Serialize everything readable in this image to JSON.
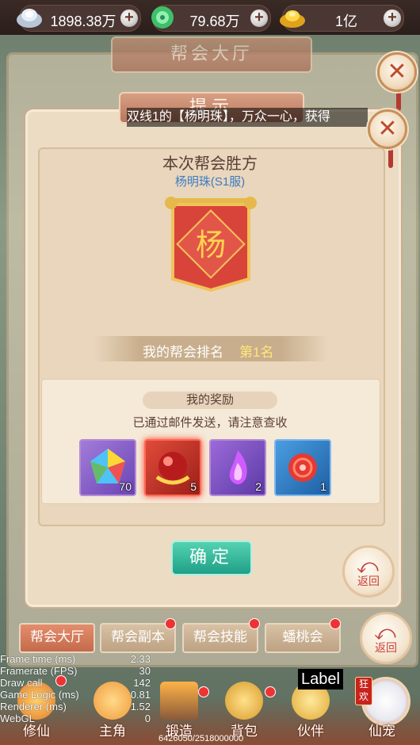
{
  "currency": {
    "silver": "1898.38万",
    "jade": "79.68万",
    "gold": "1亿",
    "plus": "+"
  },
  "hall": {
    "title": "帮会大厅"
  },
  "dialog": {
    "title": "提示",
    "marquee": "双线1的【杨明珠】，万众一心，获得",
    "winner_heading": "本次帮会胜方",
    "winner_name": "杨明珠(S1服)",
    "banner_char": "杨",
    "rank_label": "我的帮会排名",
    "rank_value": "第1名",
    "reward_title": "我的奖励",
    "reward_note": "已通过邮件发送，请注意查收",
    "rewards": [
      {
        "icon": "rainbow-gem-icon",
        "count": "70"
      },
      {
        "icon": "red-orb-icon",
        "count": "5"
      },
      {
        "icon": "purple-flame-icon",
        "count": "2"
      },
      {
        "icon": "red-disc-icon",
        "count": "1"
      }
    ],
    "confirm": "确定",
    "return": "返回"
  },
  "tabs": [
    "帮会大厅",
    "帮会副本",
    "帮会技能",
    "蟠桃会"
  ],
  "return2": "返回",
  "debug": [
    {
      "k": "Frame time (ms)",
      "v": "2.33"
    },
    {
      "k": "Framerate (FPS)",
      "v": "30"
    },
    {
      "k": "Draw call",
      "v": "142"
    },
    {
      "k": "Game Logic (ms)",
      "v": "0.81"
    },
    {
      "k": "Renderer (ms)",
      "v": "1.52"
    },
    {
      "k": "WebGL",
      "v": "0"
    }
  ],
  "label_tag": "Label",
  "memory": "6426050/2518000000",
  "nav": [
    "修仙",
    "主角",
    "锻造",
    "背包",
    "伙伴",
    "仙宠"
  ],
  "pet_badge": "狂欢",
  "colors": {
    "accent_green": "#1f9f86",
    "rank_gold": "#ffe77a",
    "winner_blue": "#3b7cc1",
    "banner_red": "#d9443a"
  }
}
